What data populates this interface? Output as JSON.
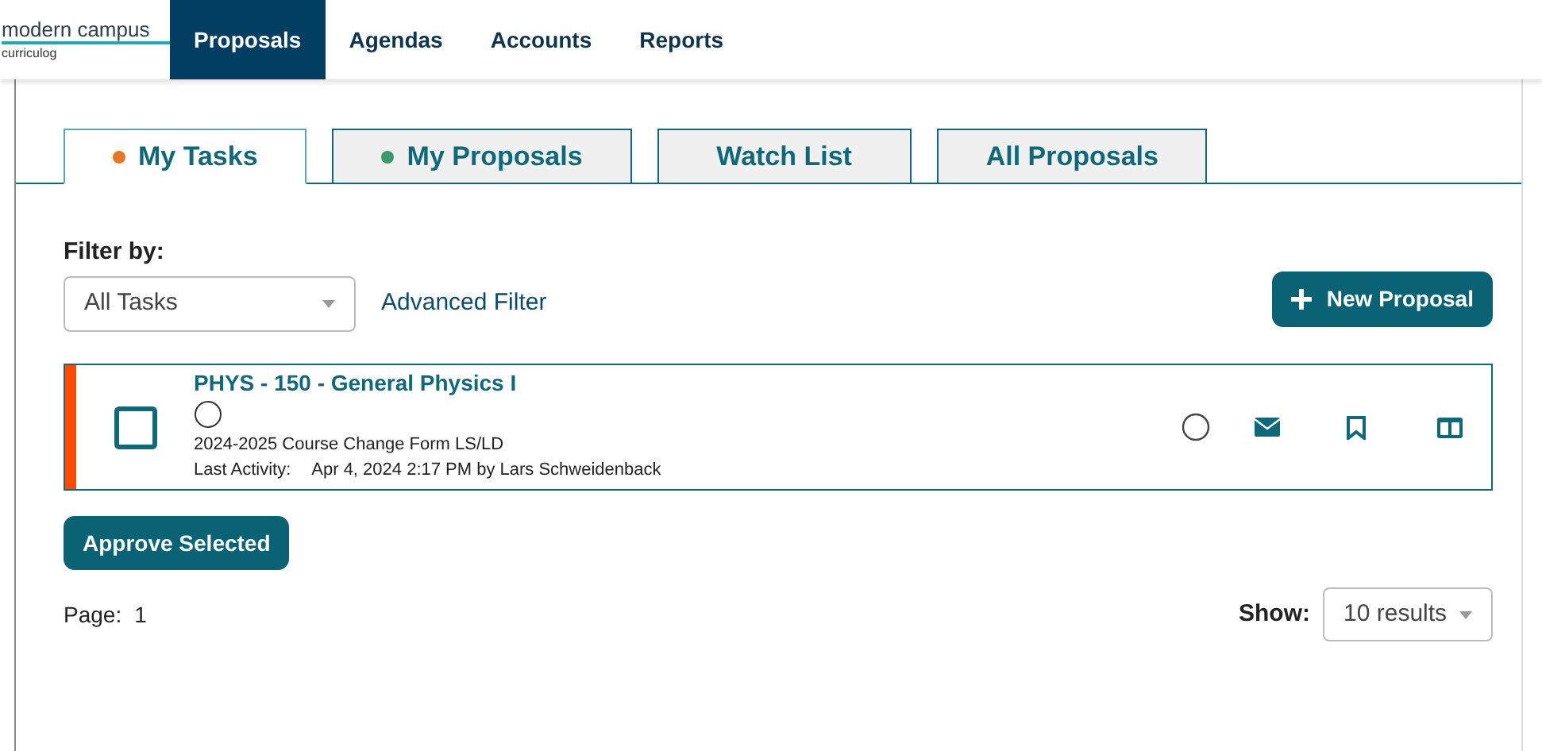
{
  "logo": {
    "name": "modern campus",
    "product": "curriculog"
  },
  "nav": [
    {
      "label": "Proposals",
      "selected": true
    },
    {
      "label": "Agendas",
      "selected": false
    },
    {
      "label": "Accounts",
      "selected": false
    },
    {
      "label": "Reports",
      "selected": false
    }
  ],
  "tabs": [
    {
      "label": "My Tasks",
      "selected": true,
      "color": "#e87722"
    },
    {
      "label": "My Proposals",
      "selected": false,
      "color": "#3a9a6a"
    },
    {
      "label": "Watch List",
      "selected": false
    },
    {
      "label": "All Proposals",
      "selected": false
    }
  ],
  "filter": {
    "label": "Filter by:",
    "value": "All Tasks",
    "advanced": "Advanced Filter"
  },
  "new_button": "New Proposal",
  "proposals": [
    {
      "title": "PHYS - 150 - General Physics I",
      "checked": false,
      "form": "2024-2025 Course Change Form LS/LD",
      "activity_label": "Last Activity:",
      "activity": "Apr 4, 2024 2:17 PM by Lars Schweidenback",
      "color": "#ff4a00"
    }
  ],
  "approve_button": "Approve Selected",
  "page": {
    "label": "Page:",
    "value": "1"
  },
  "show": {
    "label": "Show:",
    "value": "10 results"
  }
}
